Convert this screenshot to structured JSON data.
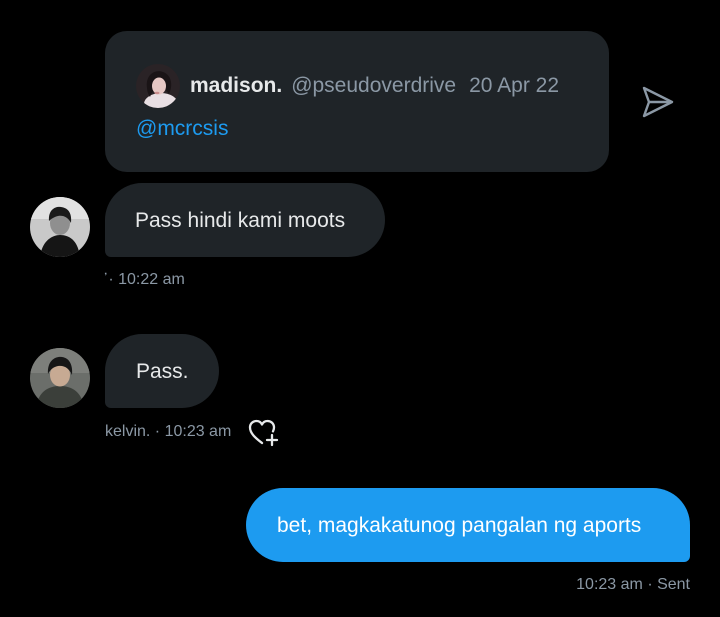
{
  "shared_tweet": {
    "author_name": "madison.",
    "author_handle": "@pseudoverdrive",
    "date": "20 Apr 22",
    "text": "@mcrcsis"
  },
  "messages": [
    {
      "text": "Pass hindi kami moots",
      "meta": "᾽· 10:22 am"
    },
    {
      "text": "Pass.",
      "meta": "kelvin. · 10:23 am"
    },
    {
      "text": "bet, magkakatunog pangalan ng aports",
      "meta": "10:23 am · Sent"
    }
  ],
  "icons": {
    "share": "share-send-icon",
    "react": "heart-plus-icon"
  },
  "colors": {
    "background": "#000000",
    "bubble_in": "#1f2428",
    "bubble_out": "#1d9bf0",
    "link": "#1d9bf0",
    "muted_text": "#8b98a5"
  }
}
